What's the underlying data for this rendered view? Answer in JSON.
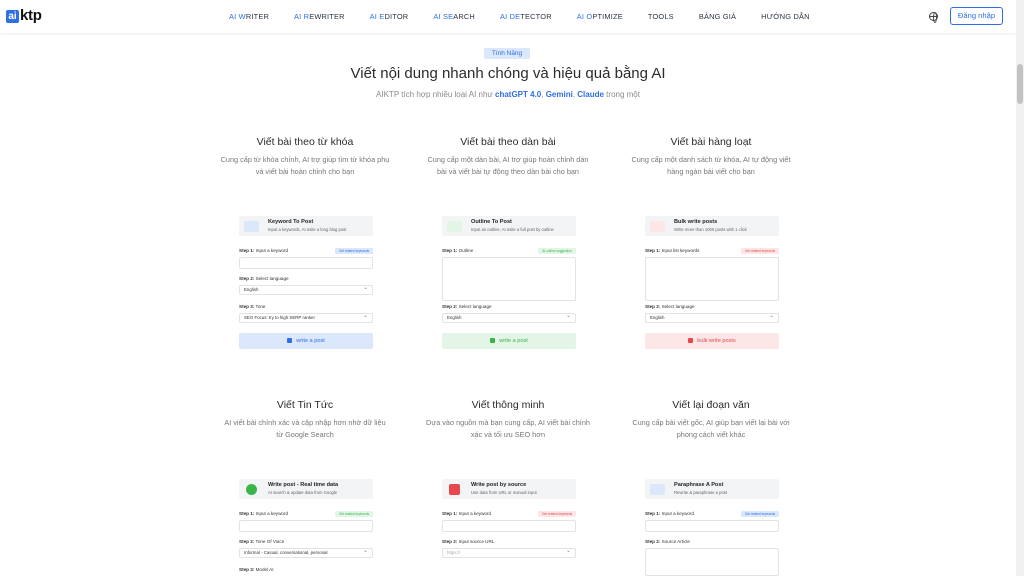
{
  "header": {
    "logo": {
      "box": "ai",
      "text": "ktp"
    },
    "nav": [
      {
        "hl": "AI W",
        "rest": "RITER"
      },
      {
        "hl": "AI R",
        "rest": "EWRITER"
      },
      {
        "hl": "AI E",
        "rest": "DITOR"
      },
      {
        "hl": "AI SE",
        "rest": "ARCH"
      },
      {
        "hl": "AI DE",
        "rest": "TECTOR"
      },
      {
        "hl": "AI O",
        "rest": "PTIMIZE"
      },
      {
        "hl": "",
        "rest": "TOOLS"
      },
      {
        "hl": "",
        "rest": "BẢNG GIÁ"
      },
      {
        "hl": "",
        "rest": "HƯỚNG DẪN"
      }
    ],
    "login_label": "Đăng nhập"
  },
  "hero": {
    "badge": "Tính Năng",
    "title": "Viết nội dung nhanh chóng và hiệu quả bằng AI",
    "sub_pre": "AIKTP tích hợp nhiều loại AI như ",
    "sub_m1": "chatGPT 4.0",
    "sub_c1": ", ",
    "sub_m2": "Gemini",
    "sub_c2": ", ",
    "sub_m3": "Claude",
    "sub_post": " trong một"
  },
  "features": [
    {
      "title": "Viết bài theo từ khóa",
      "desc": "Cung cấp từ khóa chính, AI trợ giúp tìm từ khóa phụ và viết bài hoàn chỉnh cho bạn",
      "card": {
        "title": "Keyword To Post",
        "sub": "Input a keywords, AI write a long blog post",
        "step1": {
          "label": "Step 1:",
          "text": "Input a keyword",
          "tag": "Get related keywords"
        },
        "step2": {
          "label": "Step 2:",
          "text": "Select language",
          "value": "English"
        },
        "step3": {
          "label": "Step 3:",
          "text": "Tone",
          "value": "SEO Focus: try to high SERP ranker"
        },
        "action": "write a post"
      }
    },
    {
      "title": "Viết bài theo dàn bài",
      "desc": "Cung cấp một dàn bài, AI trợ giúp hoàn chỉnh dàn bài và viết bài tự động theo dàn bài cho bạn",
      "card": {
        "title": "Outline To Post",
        "sub": "Input an outline, AI write a full post by outline",
        "step1": {
          "label": "Step 1:",
          "text": "Outline",
          "tag": "AI outline suggestion"
        },
        "step2": {
          "label": "Step 2:",
          "text": "Select language",
          "value": "English"
        },
        "action": "write a post"
      }
    },
    {
      "title": "Viết bài hàng loạt",
      "desc": "Cung cấp một danh sách từ khóa, AI tự động viết hàng ngàn bài viết cho bạn",
      "card": {
        "title": "Bulk write posts",
        "sub": "Write more than 1000 posts with 1 click",
        "step1": {
          "label": "Step 1:",
          "text": "Input list keywords",
          "tag": "Get related keywords"
        },
        "step2": {
          "label": "Step 2:",
          "text": "Select language",
          "value": "English"
        },
        "action": "bulk write posts"
      }
    },
    {
      "title": "Viết Tin Tức",
      "desc": "AI viết bài chính xác và cập nhập hơn nhờ dữ liệu từ Google Search",
      "card": {
        "title": "Write post - Real time data",
        "sub": "AI search & update data from Google",
        "step1": {
          "label": "Step 1:",
          "text": "Input a keyword",
          "tag": "Get related keywords"
        },
        "step2": {
          "label": "Step 2:",
          "text": "Tone Of Voice",
          "value": "Informal - Casual, conversational, personal"
        },
        "step3": {
          "label": "Step 3:",
          "text": "Model AI"
        }
      }
    },
    {
      "title": "Viết thông minh",
      "desc": "Dựa vào nguồn mà bạn cung cấp, AI viết bài chính xác và tối ưu SEO hơn",
      "card": {
        "title": "Write post by source",
        "sub": "Use data from URL or manual input",
        "step1": {
          "label": "Step 1:",
          "text": "Input a keyword",
          "tag": "Get related keywords"
        },
        "step2": {
          "label": "Step 2:",
          "text": "Input source URL",
          "value": "https://"
        }
      }
    },
    {
      "title": "Viết lại đoạn văn",
      "desc": "Cung cấp bài viết gốc, AI giúp bạn viết lại bài với phong cách viết khác",
      "card": {
        "title": "Paraphrase A Post",
        "sub": "Rewrite & paraphrase a post",
        "step1": {
          "label": "Step 1:",
          "text": "Input a keyword",
          "tag": "Get related keywords"
        },
        "step2": {
          "label": "Step 2:",
          "text": "Source Article"
        }
      }
    }
  ],
  "colors": {
    "blue": "#2f6fe4",
    "blue_soft": "#dbe7fb",
    "green": "#39b54a",
    "green_soft": "#e3f5e6",
    "red": "#e5484d",
    "red_soft": "#fde6e6"
  }
}
